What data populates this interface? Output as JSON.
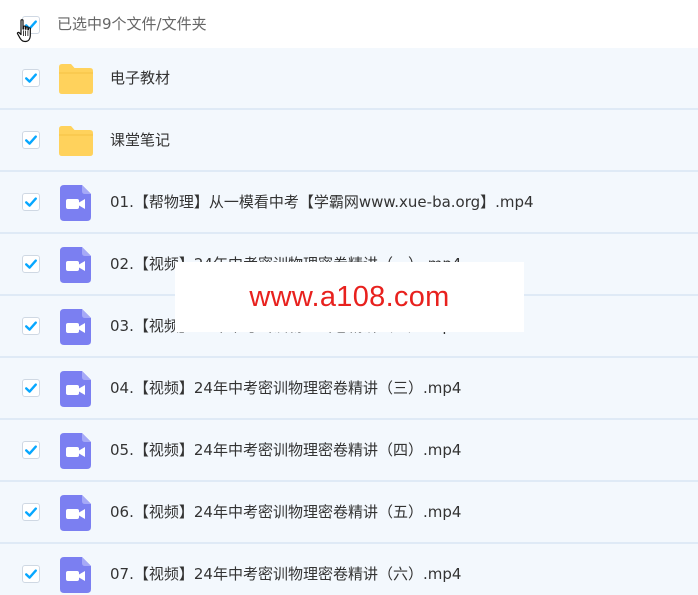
{
  "header": {
    "selection_text": "已选中9个文件/文件夹",
    "select_all_checked": true
  },
  "colors": {
    "accent": "#06a7ff",
    "folder": "#ffd25c",
    "video": "#7b7ff1",
    "row_bg": "#f3f8fd",
    "watermark_text": "#e8211e"
  },
  "files": [
    {
      "name": "电子教材",
      "type": "folder",
      "icon": "folder-icon",
      "checked": true
    },
    {
      "name": "课堂笔记",
      "type": "folder",
      "icon": "folder-icon",
      "checked": true
    },
    {
      "name": "01.【帮物理】从一模看中考【学霸网www.xue-ba.org】.mp4",
      "type": "video",
      "icon": "video-file-icon",
      "checked": true
    },
    {
      "name": "02.【视频】24年中考密训物理密卷精讲（一）.mp4",
      "type": "video",
      "icon": "video-file-icon",
      "checked": true
    },
    {
      "name": "03.【视频】24年中考密训物理密卷精讲（二）.mp4",
      "type": "video",
      "icon": "video-file-icon",
      "checked": true
    },
    {
      "name": "04.【视频】24年中考密训物理密卷精讲（三）.mp4",
      "type": "video",
      "icon": "video-file-icon",
      "checked": true
    },
    {
      "name": "05.【视频】24年中考密训物理密卷精讲（四）.mp4",
      "type": "video",
      "icon": "video-file-icon",
      "checked": true
    },
    {
      "name": "06.【视频】24年中考密训物理密卷精讲（五）.mp4",
      "type": "video",
      "icon": "video-file-icon",
      "checked": true
    },
    {
      "name": "07.【视频】24年中考密训物理密卷精讲（六）.mp4",
      "type": "video",
      "icon": "video-file-icon",
      "checked": true
    }
  ],
  "watermark": {
    "text": "www.a108.com"
  }
}
